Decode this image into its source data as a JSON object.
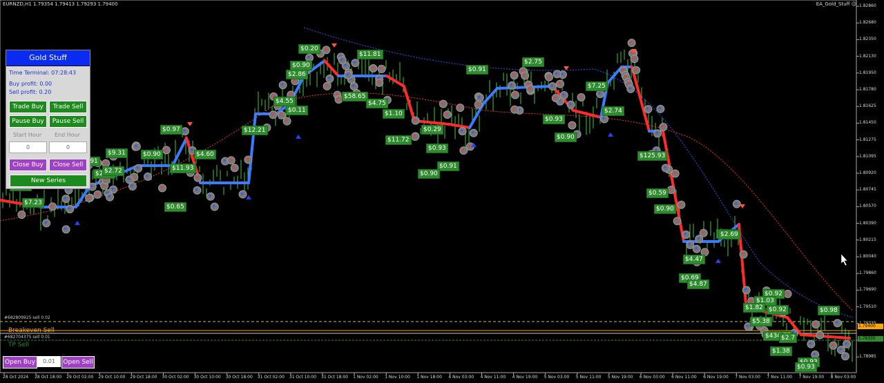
{
  "chart": {
    "symbol_title": "EURNZD,H1  1.79354 1.79413 1.79293 1.79400",
    "ea_name": "EA_Gold_Stuff",
    "price_labels": [
      "1.82860",
      "1.82680",
      "1.82350",
      "1.82130",
      "1.81950",
      "1.81780",
      "1.81625",
      "1.81450",
      "1.81275",
      "1.81095",
      "1.80920",
      "1.80745",
      "1.80570",
      "1.80390",
      "1.80215",
      "1.80040",
      "1.79860",
      "1.79690",
      "1.79510",
      "1.79335",
      "1.79160",
      "1.78985"
    ],
    "time_labels": [
      "28 Oct 2024",
      "28 Oct 18:00",
      "29 Oct 02:00",
      "29 Oct 10:00",
      "29 Oct 18:00",
      "30 Oct 02:00",
      "30 Oct 10:00",
      "30 Oct 18:00",
      "31 Oct 02:00",
      "31 Oct 10:00",
      "31 Oct 18:00",
      "1 Nov 02:00",
      "1 Nov 10:00",
      "1 Nov 18:00",
      "4 Nov 03:00",
      "4 Nov 11:00",
      "4 Nov 19:00",
      "5 Nov 03:00",
      "5 Nov 11:00",
      "5 Nov 19:00",
      "6 Nov 03:00",
      "6 Nov 11:00",
      "6 Nov 19:00",
      "7 Nov 03:00",
      "7 Nov 11:00",
      "7 Nov 19:00",
      "8 Nov 03:00"
    ],
    "current_price": "1.79400",
    "tp_price": "1.79335",
    "line_labels": {
      "sell_order_1": "#682809925 sell 0.02",
      "breakeven": "Breakeven Sell",
      "sell_order_2": "#682704375 sell 0.01",
      "tp": "TP Sell"
    },
    "colors": {
      "uptrend": "#3a7bff",
      "downtrend": "#ff2a2a",
      "profit_bg": "#2e8b2e",
      "candle": "#3fc83f",
      "panel_header": "#0a2cf0"
    },
    "profits": [
      "$0.20",
      "$11.81",
      "$0.90",
      "$2.86",
      "$2.75",
      "$0.91",
      "$4.55",
      "$0.11",
      "$58.65",
      "$4.75",
      "$7.25",
      "$0.97",
      "$1.10",
      "$2.74",
      "$12.21",
      "$0.29",
      "$0.93",
      "$11.72",
      "$0.90",
      "$0.93",
      "$0.91",
      "$0.90",
      "$4.60",
      "$11.93",
      "$9.31",
      "$0.90",
      "$0.91",
      "$2.73",
      "$2.72",
      "$0.90",
      "$7.23",
      "$0.65",
      "$125.93",
      "$0.59",
      "$0.90",
      "$0.03",
      "$2.69",
      "$4.47",
      "$0.69",
      "$4.87",
      "$0.92",
      "$1.03",
      "$1.82",
      "$0.92",
      "$5.38",
      "$0.98",
      "$434.75",
      "$2.7",
      "$1.38",
      "$0.93",
      "$0.93",
      "$0.91"
    ]
  },
  "panel": {
    "title": "Gold Stuff",
    "time_terminal": "Time Terminal: 07:28:43",
    "buy_profit": "Buy profit: 0.00",
    "sell_profit": "Sell profit: 0.20",
    "trade_buy": "Trade Buy",
    "trade_sell": "Trade Sell",
    "pause_buy": "Pause Buy",
    "pause_sell": "Pause Sell",
    "start_hour_label": "Start Hour",
    "end_hour_label": "End Hour",
    "start_hour_value": "0",
    "end_hour_value": "0",
    "close_buy": "Close Buy",
    "close_sell": "Close Sell",
    "new_series": "New Series"
  },
  "bottom": {
    "open_buy": "Open Buy",
    "lot_value": "0.01",
    "open_sell": "Open Sell"
  }
}
